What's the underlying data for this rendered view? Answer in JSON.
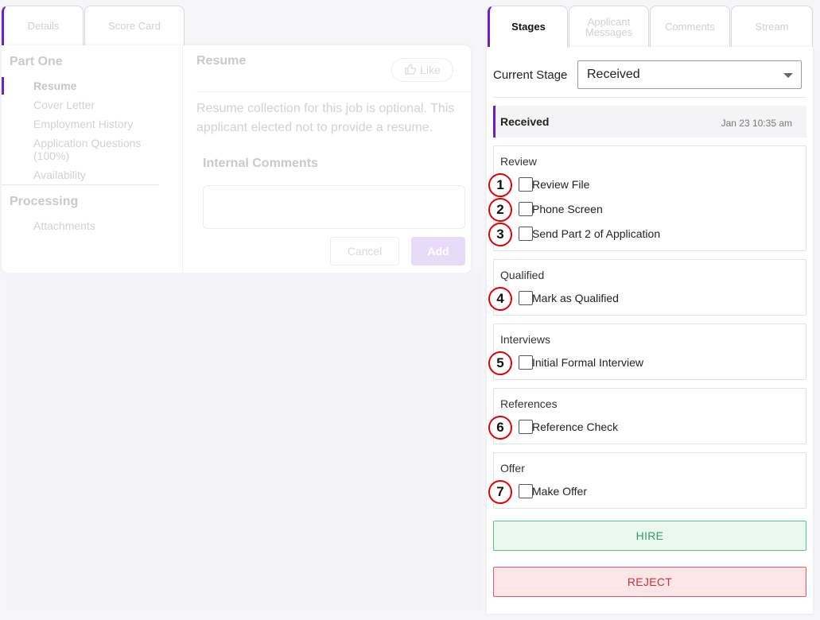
{
  "left_tabs": {
    "details": "Details",
    "score_card": "Score Card"
  },
  "left_nav": {
    "part_one": "Part One",
    "items": [
      "Resume",
      "Cover Letter",
      "Employment History",
      "Application Questions",
      "(100%)",
      "Availability"
    ],
    "processing": "Processing",
    "processing_items": [
      "Attachments"
    ]
  },
  "content": {
    "title": "Resume",
    "like": "Like",
    "note": "Resume collection for this job is optional. This applicant elected not to provide a resume.",
    "internal_comments": "Internal Comments",
    "cancel": "Cancel",
    "add": "Add"
  },
  "right_tabs": {
    "stages": "Stages",
    "applicant_messages_1": "Applicant",
    "applicant_messages_2": "Messages",
    "comments": "Comments",
    "stream": "Stream"
  },
  "current_stage": {
    "label": "Current Stage",
    "value": "Received"
  },
  "stage_header": {
    "name": "Received",
    "time": "Jan 23 10:35 am"
  },
  "groups": [
    {
      "title": "Review",
      "tasks": [
        {
          "num": "1",
          "label": "Review File"
        },
        {
          "num": "2",
          "label": "Phone Screen"
        },
        {
          "num": "3",
          "label": "Send Part 2 of Application"
        }
      ]
    },
    {
      "title": "Qualified",
      "tasks": [
        {
          "num": "4",
          "label": "Mark as Qualified"
        }
      ]
    },
    {
      "title": "Interviews",
      "tasks": [
        {
          "num": "5",
          "label": "Initial Formal Interview"
        }
      ]
    },
    {
      "title": "References",
      "tasks": [
        {
          "num": "6",
          "label": "Reference Check"
        }
      ]
    },
    {
      "title": "Offer",
      "tasks": [
        {
          "num": "7",
          "label": "Make Offer"
        }
      ]
    }
  ],
  "actions": {
    "hire": "HIRE",
    "reject": "REJECT"
  }
}
